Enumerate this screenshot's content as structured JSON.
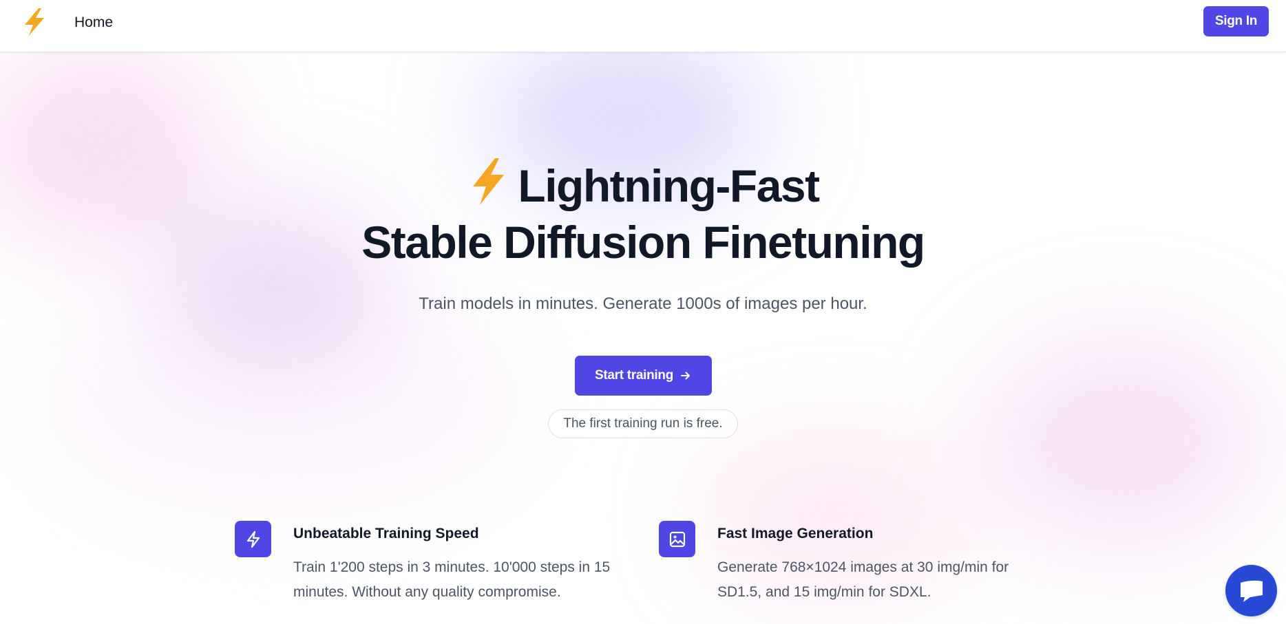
{
  "header": {
    "logo_icon": "lightning-bolt-icon",
    "nav_home": "Home",
    "sign_in": "Sign In"
  },
  "hero": {
    "title_icon": "lightning-bolt-icon",
    "title_line1": "Lightning-Fast",
    "title_line2": "Stable Diffusion Finetuning",
    "subtitle": "Train models in minutes. Generate 1000s of images per hour.",
    "cta_label": "Start training",
    "cta_icon": "arrow-right-icon",
    "free_note": "The first training run is free."
  },
  "features": [
    {
      "icon": "lightning-bolt-icon",
      "title": "Unbeatable Training Speed",
      "description": "Train 1'200 steps in 3 minutes. 10'000 steps in 15 minutes. Without any quality compromise."
    },
    {
      "icon": "image-icon",
      "title": "Fast Image Generation",
      "description": "Generate 768×1024 images at 30 img/min for SD1.5, and 15 img/min for SDXL."
    }
  ],
  "chat": {
    "icon": "chat-bubble-icon"
  },
  "colors": {
    "accent": "#4f46e5",
    "bolt": "#f5a623",
    "chat": "#2749d6",
    "text": "#111827",
    "muted": "#4b5563"
  }
}
